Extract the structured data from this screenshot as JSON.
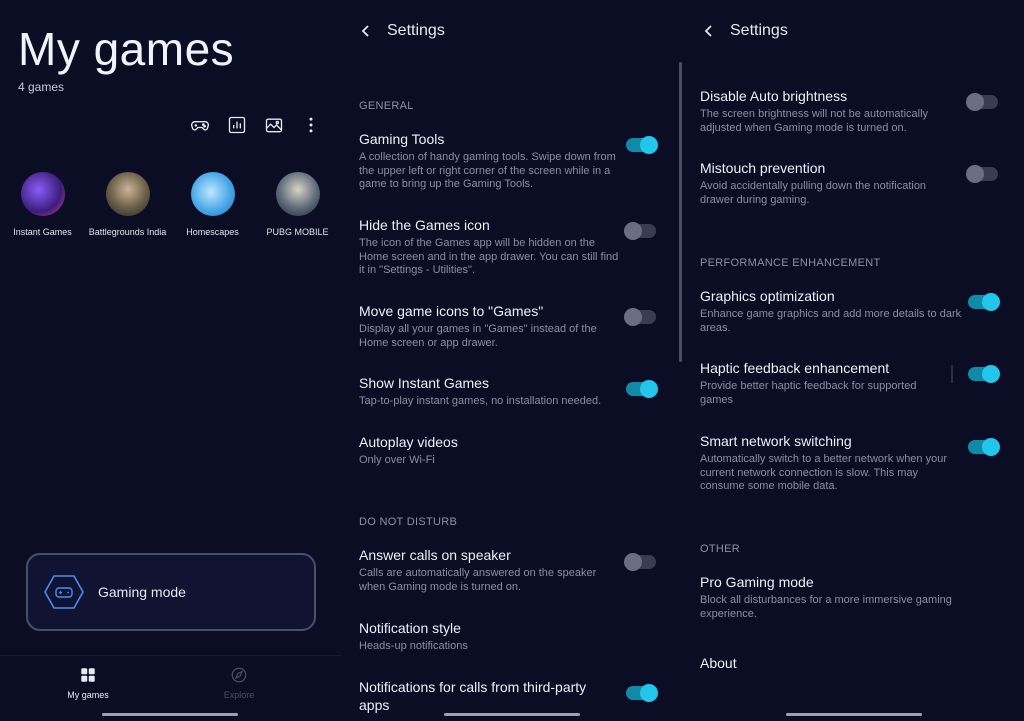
{
  "my_games": {
    "title": "My games",
    "count": "4 games",
    "toolbar_icons": [
      "gamepad-icon",
      "stats-icon",
      "gallery-icon",
      "more-vertical-icon"
    ],
    "games": [
      {
        "label": "Instant Games"
      },
      {
        "label": "Battlegrounds India"
      },
      {
        "label": "Homescapes"
      },
      {
        "label": "PUBG MOBILE"
      }
    ],
    "gaming_mode_label": "Gaming mode",
    "nav": {
      "my_games": "My games",
      "explore": "Explore"
    }
  },
  "settings1": {
    "title": "Settings",
    "sections": {
      "general": "GENERAL",
      "dnd": "DO NOT DISTURB"
    },
    "items": [
      {
        "title": "Gaming Tools",
        "desc": "A collection of handy gaming tools. Swipe down from the upper left or right corner of the screen while in a game to bring up the Gaming Tools.",
        "toggle": "on"
      },
      {
        "title": "Hide the Games icon",
        "desc": "The icon of the Games app will be hidden on the Home screen and in the app drawer. You can still find it in \"Settings - Utilities\".",
        "toggle": "off"
      },
      {
        "title": "Move game icons to \"Games\"",
        "desc": "Display all your games in \"Games\" instead of the Home screen or app drawer.",
        "toggle": "off"
      },
      {
        "title": "Show Instant Games",
        "desc": "Tap-to-play instant games, no installation needed.",
        "toggle": "on"
      },
      {
        "title": "Autoplay videos",
        "desc": "Only over Wi-Fi"
      },
      {
        "title": "Answer calls on speaker",
        "desc": "Calls are automatically answered on the speaker when Gaming mode is turned on.",
        "toggle": "off"
      },
      {
        "title": "Notification style",
        "desc": "Heads-up notifications"
      },
      {
        "title": "Notifications for calls from third-party apps",
        "toggle": "on"
      }
    ]
  },
  "settings2": {
    "title": "Settings",
    "sections": {
      "performance": "PERFORMANCE ENHANCEMENT",
      "other": "OTHER"
    },
    "items": [
      {
        "title": "Disable Auto brightness",
        "desc": "The screen brightness will not be automatically adjusted when Gaming mode is turned on.",
        "toggle": "off"
      },
      {
        "title": "Mistouch prevention",
        "desc": "Avoid accidentally pulling down the notification drawer during gaming.",
        "toggle": "off"
      },
      {
        "title": "Graphics optimization",
        "desc": "Enhance game graphics and add more details to dark areas.",
        "toggle": "on"
      },
      {
        "title": "Haptic feedback enhancement",
        "desc": "Provide better haptic feedback for supported games",
        "toggle": "on"
      },
      {
        "title": "Smart network switching",
        "desc": "Automatically switch to a better network when your current network connection is slow. This may consume some mobile data.",
        "toggle": "on"
      },
      {
        "title": "Pro Gaming mode",
        "desc": "Block all disturbances for a more immersive gaming experience."
      },
      {
        "title": "About"
      }
    ]
  },
  "colors": {
    "background": "#0b0d24",
    "accent": "#22c6ea",
    "toggle_track_on": "#0f8aa8",
    "toggle_off": "#3a3d52"
  }
}
